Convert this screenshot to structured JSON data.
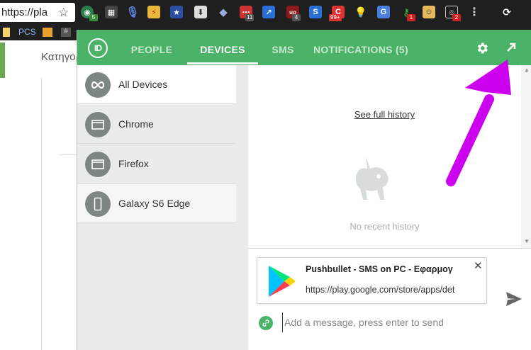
{
  "browser": {
    "url_text": "https://pla",
    "bookmark_label": "PCS",
    "extension_badges": [
      "5",
      "11",
      "4",
      "99+",
      "1",
      "2"
    ]
  },
  "page_behind": {
    "tab_text": "Κατηγορ"
  },
  "popup": {
    "logo_text": "ID",
    "tabs": [
      {
        "label": "PEOPLE",
        "active": false
      },
      {
        "label": "DEVICES",
        "active": true
      },
      {
        "label": "SMS",
        "active": false
      },
      {
        "label": "NOTIFICATIONS (5)",
        "active": false
      }
    ],
    "accent_color": "#4ab367",
    "devices": [
      {
        "label": "All Devices",
        "icon": "infinity-icon",
        "selected": true
      },
      {
        "label": "Chrome",
        "icon": "browser-window-icon"
      },
      {
        "label": "Firefox",
        "icon": "browser-window-icon"
      },
      {
        "label": "Galaxy S6 Edge",
        "icon": "phone-icon"
      }
    ],
    "history": {
      "see_full_history": "See full history",
      "empty_text": "No recent history"
    },
    "compose": {
      "card_title": "Pushbullet - SMS on PC - Εφαρμογ",
      "card_url": "https://play.google.com/store/apps/det",
      "message_placeholder": "Add a message, press enter to send"
    }
  }
}
